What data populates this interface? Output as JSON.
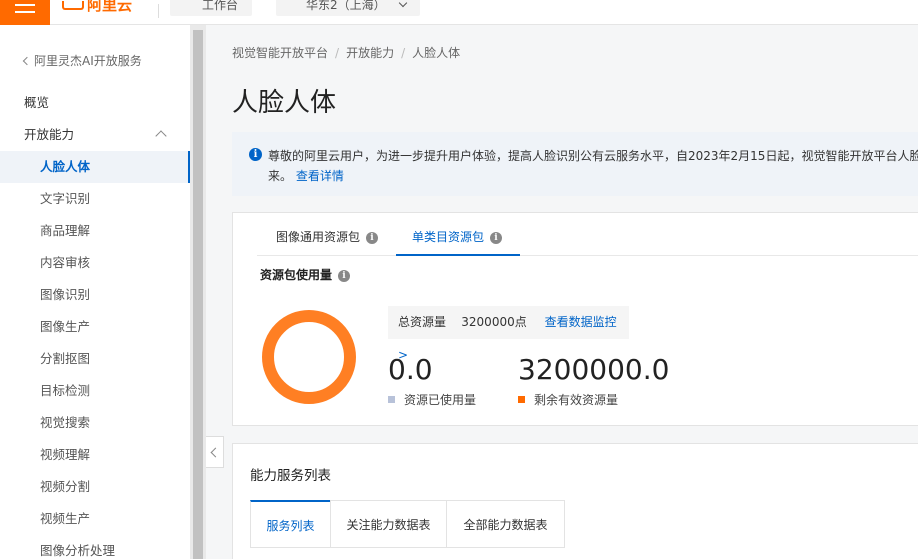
{
  "topbar": {
    "logo_text": "阿里云",
    "workbench_label": "工作台",
    "region_label": "华东2（上海）"
  },
  "sidebar": {
    "back_label": "阿里灵杰AI开放服务",
    "items": [
      {
        "label": "概览"
      },
      {
        "label": "开放能力"
      },
      {
        "label": "人脸人体"
      },
      {
        "label": "文字识别"
      },
      {
        "label": "商品理解"
      },
      {
        "label": "内容审核"
      },
      {
        "label": "图像识别"
      },
      {
        "label": "图像生产"
      },
      {
        "label": "分割抠图"
      },
      {
        "label": "目标检测"
      },
      {
        "label": "视觉搜索"
      },
      {
        "label": "视频理解"
      },
      {
        "label": "视频分割"
      },
      {
        "label": "视频生产"
      },
      {
        "label": "图像分析处理"
      }
    ]
  },
  "breadcrumb": [
    "视觉智能开放平台",
    "开放能力",
    "人脸人体"
  ],
  "page_title": "人脸人体",
  "notice": {
    "text": "尊敬的阿里云用户，为进一步提升用户体验，提高人脸识别公有云服务水平，自2023年2月15日起，视觉智能开放平台人脸识",
    "text2": "来。",
    "link": "查看详情"
  },
  "resource_card": {
    "tabs": [
      "图像通用资源包",
      "单类目资源包"
    ],
    "active_tab": 1,
    "usage_title": "资源包使用量",
    "total_label": "总资源量",
    "total_value": "3200000点",
    "monitor_link": "查看数据监控 >",
    "used_value": "0.0",
    "used_label": "资源已使用量",
    "remaining_value": "3200000.0",
    "remaining_label": "剩余有效资源量",
    "colors": {
      "used": "#b8c2d9",
      "remaining": "#ff6a00",
      "ring": "#ff7f23"
    }
  },
  "service_card": {
    "title": "能力服务列表",
    "tabs": [
      "服务列表",
      "关注能力数据表",
      "全部能力数据表"
    ]
  }
}
